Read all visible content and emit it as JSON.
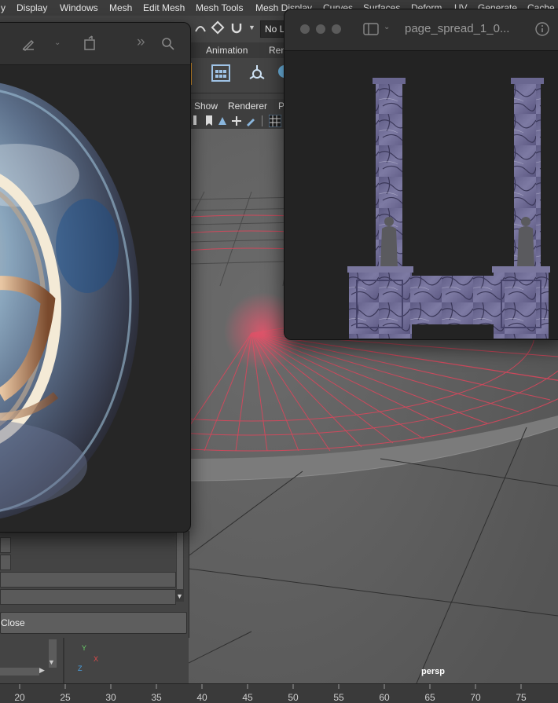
{
  "menubar": {
    "items": [
      "y",
      "Display",
      "Windows",
      "Mesh",
      "Edit Mesh",
      "Mesh Tools",
      "Mesh Display",
      "Curves",
      "Surfaces",
      "Deform",
      "UV",
      "Generate",
      "Cache"
    ]
  },
  "toolbar": {
    "live_field": "No L"
  },
  "shelf": {
    "tabs": [
      "Animation",
      "Ren"
    ]
  },
  "panel_menu": {
    "items": [
      "Show",
      "Renderer",
      "P"
    ]
  },
  "preview_right": {
    "title": "page_spread_1_0..."
  },
  "dialog": {
    "close_label": "Close"
  },
  "viewport": {
    "camera_label": "persp",
    "axis_y": "Y",
    "axis_x": "X",
    "axis_z": "Z"
  },
  "timeline": {
    "ticks": [
      "20",
      "25",
      "30",
      "35",
      "40",
      "45",
      "50",
      "55",
      "60",
      "65",
      "70",
      "75"
    ]
  },
  "colors": {
    "grid_accent": "#d8475c",
    "marble": "#6e6a92"
  }
}
